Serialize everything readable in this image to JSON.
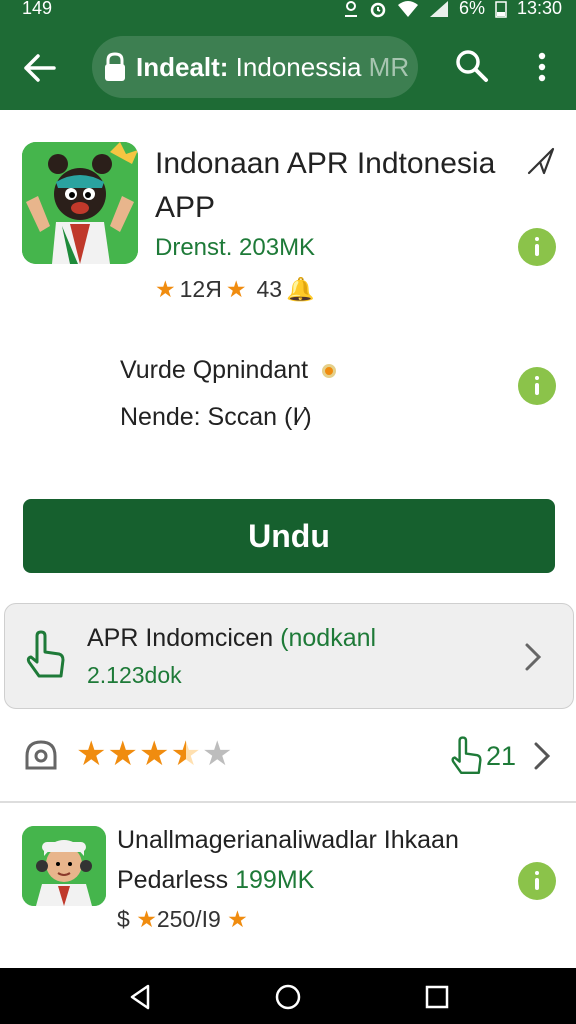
{
  "status_bar": {
    "time_left": "149",
    "battery": "6%",
    "time": "13:30"
  },
  "search": {
    "text_bold": "Indealt:",
    "text_main": " Indonessia",
    "text_dim": " MR"
  },
  "app": {
    "title": "Indonaan APR Indtonesia APP",
    "developer": "Drenst. 203MK",
    "rating_text": "12Я",
    "reviews": "43"
  },
  "details": {
    "line1": "Vurde Qpnindant",
    "line2": "Nende: Sccan (I⁄)"
  },
  "install": {
    "label": "Undu"
  },
  "related": {
    "title": "APR Indomcicen",
    "title_green": "(nodkanl",
    "subtitle": "2.123dok"
  },
  "rating_row": {
    "stars": 3.5,
    "likes": "21"
  },
  "list_item": {
    "title": "Unallmagerianaliwadlar Ihkaan",
    "sub_prefix": "Pedarless",
    "sub_green": "199MK",
    "rating_prefix": "$",
    "rating_value": "250/I9"
  },
  "colors": {
    "brand_green": "#1e6b35",
    "accent_orange": "#f08c0f",
    "info_green": "#8bc34a"
  }
}
